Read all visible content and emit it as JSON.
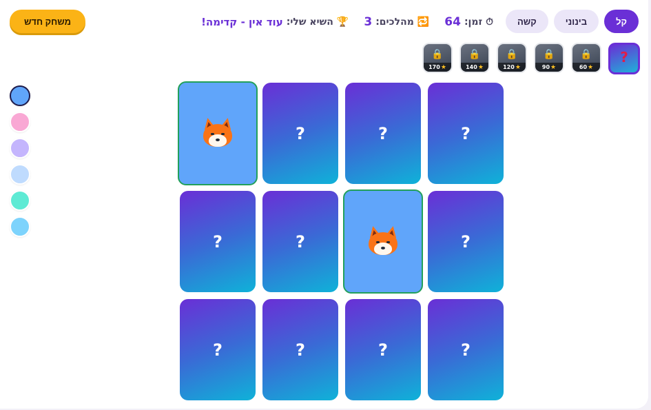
{
  "header": {
    "new_game_label": "משחק חדש",
    "difficulty": [
      {
        "label": "קל",
        "active": true
      },
      {
        "label": "בינוני",
        "active": false
      },
      {
        "label": "קשה",
        "active": false
      }
    ],
    "stats": {
      "time_label": "זמן:",
      "time_value": "64",
      "time_icon": "stopwatch-icon",
      "moves_label": "מהלכים:",
      "moves_value": "3",
      "moves_icon": "repeat-icon",
      "best_label": "השיא שלי:",
      "best_value": "עוד אין - קדימה!",
      "best_icon": "trophy-icon"
    }
  },
  "themes": [
    {
      "name": "mystery",
      "active": true,
      "locked": false,
      "cost": ""
    },
    {
      "name": "theme-60",
      "active": false,
      "locked": true,
      "cost": "60"
    },
    {
      "name": "theme-90",
      "active": false,
      "locked": true,
      "cost": "90"
    },
    {
      "name": "theme-120",
      "active": false,
      "locked": true,
      "cost": "120"
    },
    {
      "name": "theme-140",
      "active": false,
      "locked": true,
      "cost": "140"
    },
    {
      "name": "theme-170",
      "active": false,
      "locked": true,
      "cost": "170"
    }
  ],
  "swatches": [
    {
      "color": "#60a5fa",
      "active": true
    },
    {
      "color": "#f9a8d4",
      "active": false
    },
    {
      "color": "#c4b5fd",
      "active": false
    },
    {
      "color": "#bfdbfe",
      "active": false
    },
    {
      "color": "#5eead4",
      "active": false
    },
    {
      "color": "#7dd3fc",
      "active": false
    }
  ],
  "board": {
    "hidden_symbol": "?",
    "cards": [
      {
        "state": "up",
        "face": "fox-icon"
      },
      {
        "state": "down"
      },
      {
        "state": "down"
      },
      {
        "state": "down"
      },
      {
        "state": "down"
      },
      {
        "state": "down"
      },
      {
        "state": "up",
        "face": "fox-icon"
      },
      {
        "state": "down"
      },
      {
        "state": "down"
      },
      {
        "state": "down"
      },
      {
        "state": "down"
      },
      {
        "state": "down"
      }
    ]
  }
}
